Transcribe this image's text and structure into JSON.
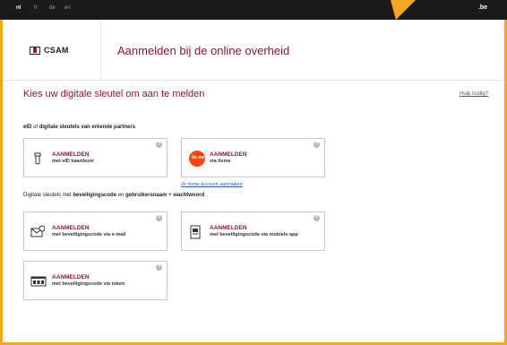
{
  "topbar": {
    "languages": [
      "nl",
      "fr",
      "de",
      "en"
    ],
    "domain": ".be"
  },
  "header": {
    "logo_text": "CSAM",
    "title": "Aanmelden bij de online overheid"
  },
  "main": {
    "subtitle": "Kies uw digitale sleutel om aan te melden",
    "help_link": "Hulp nodig?",
    "section1": {
      "prefix": "eID",
      "middle": " of ",
      "bold": "digitale sleutels van erkende partners"
    },
    "section2": {
      "prefix": "Digitale sleutels met ",
      "bold1": "beveiligingscode",
      "middle": " en ",
      "bold2": "gebruikersnaam + wachtwoord"
    },
    "cards": [
      {
        "title": "AANMELDEN",
        "sub": "met eID kaartlezer",
        "icon": "card-reader-icon"
      },
      {
        "title": "AANMELDEN",
        "sub": "via itsme",
        "icon": "itsme-icon"
      },
      {
        "title": "AANMELDEN",
        "sub": "met beveiligingscode via e-mail",
        "icon": "email-icon"
      },
      {
        "title": "AANMELDEN",
        "sub": "met beveiligingscode via mobiele app",
        "icon": "mobile-app-icon"
      },
      {
        "title": "AANMELDEN",
        "sub": "met beveiligingscode via token",
        "icon": "token-icon"
      }
    ],
    "itsme_link": "Je itsme-account aanmaken",
    "info_glyph": "?",
    "itsme_label": "its me"
  },
  "colors": {
    "accent": "#f5a623",
    "brand": "#8b1538",
    "topbar": "#1a1a1a"
  }
}
